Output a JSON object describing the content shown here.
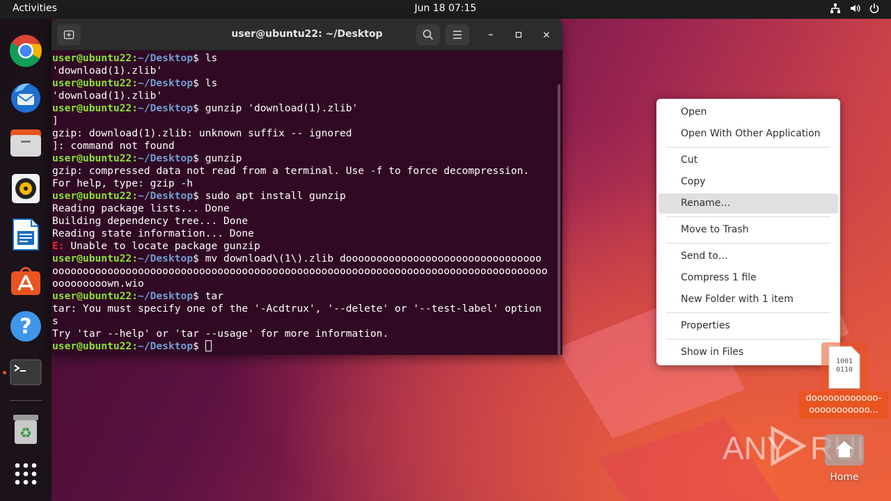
{
  "topbar": {
    "activities": "Activities",
    "clock": "Jun 18  07:15"
  },
  "dock": {
    "items": [
      {
        "name": "Google Chrome",
        "icon": "chrome-icon"
      },
      {
        "name": "Thunderbird Mail",
        "icon": "thunderbird-icon"
      },
      {
        "name": "Files",
        "icon": "files-icon"
      },
      {
        "name": "Rhythmbox",
        "icon": "rhythmbox-icon"
      },
      {
        "name": "LibreOffice Writer",
        "icon": "writer-icon"
      },
      {
        "name": "Ubuntu Software",
        "icon": "software-icon"
      },
      {
        "name": "Help",
        "icon": "help-icon"
      },
      {
        "name": "Terminal",
        "icon": "terminal-icon",
        "running": true
      },
      {
        "name": "Trash",
        "icon": "trash-icon"
      },
      {
        "name": "Show Applications",
        "icon": "apps-grid-icon"
      }
    ]
  },
  "terminal": {
    "title": "user@ubuntu22: ~/Desktop",
    "prompt_user": "user@ubuntu22",
    "prompt_path": "~/Desktop",
    "lines": [
      {
        "type": "prompt",
        "cmd": " ls"
      },
      {
        "type": "out",
        "text": "'download(1).zlib'"
      },
      {
        "type": "prompt",
        "cmd": " ls"
      },
      {
        "type": "out",
        "text": "'download(1).zlib'"
      },
      {
        "type": "prompt",
        "cmd": " gunzip 'download(1).zlib'"
      },
      {
        "type": "out",
        "text": "]"
      },
      {
        "type": "out",
        "text": "gzip: download(1).zlib: unknown suffix -- ignored"
      },
      {
        "type": "out",
        "text": "]: command not found"
      },
      {
        "type": "prompt",
        "cmd": " gunzip"
      },
      {
        "type": "out",
        "text": "gzip: compressed data not read from a terminal. Use -f to force decompression."
      },
      {
        "type": "out",
        "text": "For help, type: gzip -h"
      },
      {
        "type": "prompt",
        "cmd": " sudo apt install gunzip"
      },
      {
        "type": "out",
        "text": "Reading package lists... Done"
      },
      {
        "type": "out",
        "text": "Building dependency tree... Done"
      },
      {
        "type": "out",
        "text": "Reading state information... Done"
      },
      {
        "type": "error",
        "prefix": "E:",
        "text": " Unable to locate package gunzip"
      },
      {
        "type": "prompt",
        "cmd": " mv download\\(1\\).zlib doooooooooooooooooooooooooooooooo"
      },
      {
        "type": "out",
        "text": "ooooooooooooooooooooooooooooooooooooooooooooooooooooooooooooooooooooooooooooooooo"
      },
      {
        "type": "out",
        "text": "ooooooooown.wio"
      },
      {
        "type": "prompt",
        "cmd": " tar"
      },
      {
        "type": "out",
        "text": "tar: You must specify one of the '-Acdtrux', '--delete' or '--test-label' option"
      },
      {
        "type": "out",
        "text": "s"
      },
      {
        "type": "out",
        "text": "Try 'tar --help' or 'tar --usage' for more information."
      },
      {
        "type": "prompt-cursor",
        "cmd": " "
      }
    ]
  },
  "context_menu": {
    "items": [
      {
        "label": "Open"
      },
      {
        "label": "Open With Other Application"
      },
      {
        "label": "Cut"
      },
      {
        "label": "Copy"
      },
      {
        "label": "Rename…",
        "highlighted": true
      },
      {
        "label": "Move to Trash"
      },
      {
        "label": "Send to…"
      },
      {
        "label": "Compress 1 file"
      },
      {
        "label": "New Folder with 1 item"
      },
      {
        "label": "Properties"
      },
      {
        "label": "Show in Files"
      }
    ]
  },
  "desktop": {
    "file_label": "doooooooooooo-ooooooooooo...",
    "file_icon_text": "1001 0110",
    "home_label": "Home"
  },
  "watermark": {
    "text_left": "ANY",
    "text_right": "RUN"
  },
  "colors": {
    "accent": "#e95420",
    "terminal_bg": "#300a24",
    "prompt_user": "#8ae234",
    "prompt_path": "#729fcf",
    "error": "#ef2929"
  }
}
